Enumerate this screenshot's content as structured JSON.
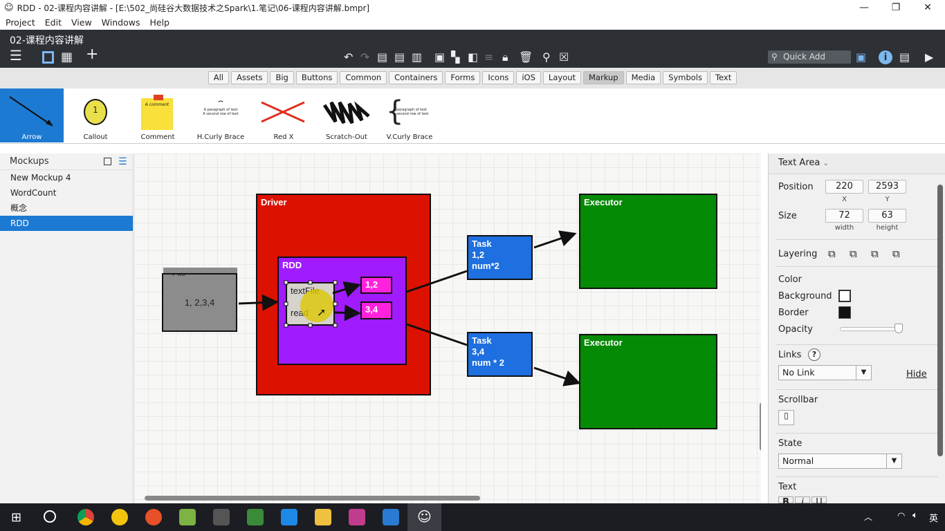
{
  "window": {
    "title": "RDD - 02-课程内容讲解 - [E:\\502_尚硅谷大数据技术之Spark\\1.笔记\\06-课程内容讲解.bmpr]",
    "minimize": "—",
    "restore": "❐",
    "close": "✕"
  },
  "menu": [
    "Project",
    "Edit",
    "View",
    "Windows",
    "Help"
  ],
  "header": {
    "document_title": "02-课程内容讲解",
    "quick_add_placeholder": "Quick Add"
  },
  "categories": [
    {
      "label": "All"
    },
    {
      "label": "Assets"
    },
    {
      "label": "Big"
    },
    {
      "label": "Buttons"
    },
    {
      "label": "Common"
    },
    {
      "label": "Containers"
    },
    {
      "label": "Forms"
    },
    {
      "label": "Icons"
    },
    {
      "label": "iOS"
    },
    {
      "label": "Layout"
    },
    {
      "label": "Markup",
      "selected": true
    },
    {
      "label": "Media"
    },
    {
      "label": "Symbols"
    },
    {
      "label": "Text"
    }
  ],
  "library": [
    {
      "label": "Arrow",
      "selected": true
    },
    {
      "label": "Callout"
    },
    {
      "label": "Comment"
    },
    {
      "label": "H.Curly Brace"
    },
    {
      "label": "Red X"
    },
    {
      "label": "Scratch-Out"
    },
    {
      "label": "V.Curly Brace"
    }
  ],
  "library_previews": {
    "callout_number": "1",
    "comment_text": "A comment",
    "curly_text_1": "A paragraph of text",
    "curly_text_2": "A second row of text"
  },
  "mockups": {
    "title": "Mockups",
    "items": [
      {
        "label": "New Mockup 4"
      },
      {
        "label": "WordCount"
      },
      {
        "label": "概念"
      },
      {
        "label": "RDD",
        "selected": true
      }
    ]
  },
  "canvas": {
    "file": {
      "title": "File",
      "value": "1, 2,3,4",
      "color": "#8c8c8c"
    },
    "driver": {
      "title": "Driver",
      "color": "#dd1100"
    },
    "rdd": {
      "title": "RDD",
      "color": "#a01cff"
    },
    "textarea": {
      "line1": "textFile",
      "line2": "read",
      "color": "#d6d2cc"
    },
    "part1": {
      "label": "1,2",
      "color": "#ff22dd"
    },
    "part2": {
      "label": "3,4",
      "color": "#ff22dd"
    },
    "task1": {
      "line1": "Task",
      "line2": "1,2",
      "line3": "num*2",
      "color": "#1e6fe0"
    },
    "task2": {
      "line1": "Task",
      "line2": "3,4",
      "line3": "num * 2",
      "color": "#1e6fe0"
    },
    "executor1": {
      "title": "Executor",
      "color": "#058a05"
    },
    "executor2": {
      "title": "Executor",
      "color": "#058a05"
    }
  },
  "properties": {
    "type": "Text Area",
    "position_label": "Position",
    "x": "220",
    "y": "2593",
    "x_label": "X",
    "y_label": "Y",
    "size_label": "Size",
    "width": "72",
    "height": "63",
    "width_label": "width",
    "height_label": "height",
    "layering_label": "Layering",
    "color_label": "Color",
    "background_label": "Background",
    "border_label": "Border",
    "opacity_label": "Opacity",
    "opacity": 1.0,
    "links_label": "Links",
    "help": "?",
    "link_value": "No Link",
    "hide": "Hide",
    "scrollbar_label": "Scrollbar",
    "state_label": "State",
    "state_value": "Normal",
    "text_label": "Text",
    "text_buttons": [
      "B",
      "i",
      "U"
    ]
  },
  "taskbar": {
    "ime": "英"
  }
}
